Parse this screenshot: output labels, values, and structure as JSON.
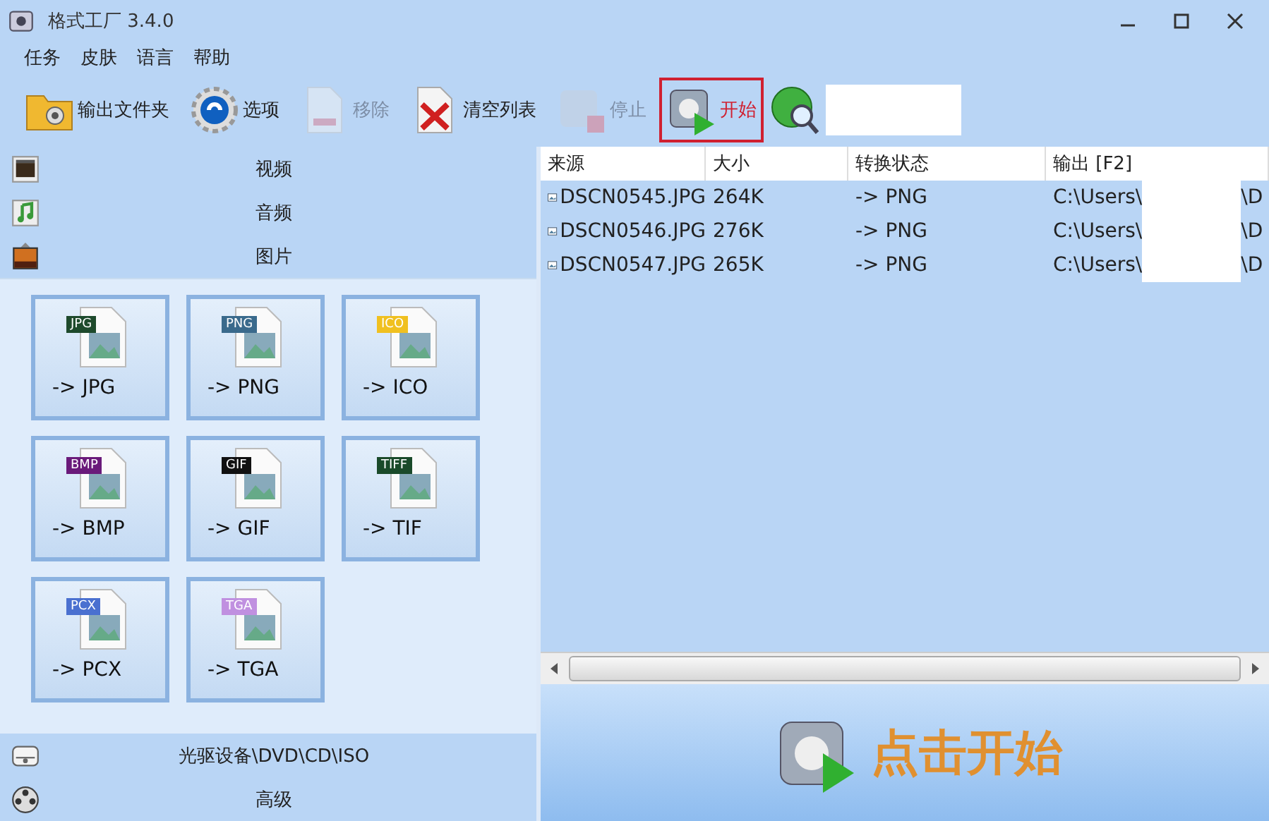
{
  "window": {
    "title": "格式工厂 3.4.0"
  },
  "menu": [
    "任务",
    "皮肤",
    "语言",
    "帮助"
  ],
  "toolbar": [
    {
      "label": "输出文件夹",
      "kind": "folder",
      "disabled": false,
      "selected": false
    },
    {
      "label": "选项",
      "kind": "gear",
      "disabled": false,
      "selected": false
    },
    {
      "label": "移除",
      "kind": "remove",
      "disabled": true,
      "selected": false
    },
    {
      "label": "清空列表",
      "kind": "clear",
      "disabled": false,
      "selected": false
    },
    {
      "label": "停止",
      "kind": "stop",
      "disabled": true,
      "selected": false
    },
    {
      "label": "开始",
      "kind": "start",
      "disabled": false,
      "selected": true
    }
  ],
  "sidebar": {
    "top": [
      {
        "label": "视频",
        "kind": "video",
        "expanded": false
      },
      {
        "label": "音频",
        "kind": "audio",
        "expanded": false
      },
      {
        "label": "图片",
        "kind": "picture",
        "expanded": true
      }
    ],
    "tiles": [
      {
        "label": "-> JPG",
        "tag": "JPG",
        "color": "#1e4a2c"
      },
      {
        "label": "-> PNG",
        "tag": "PNG",
        "color": "#3a6a8c"
      },
      {
        "label": "-> ICO",
        "tag": "ICO",
        "color": "#f0c020"
      },
      {
        "label": "-> BMP",
        "tag": "BMP",
        "color": "#6a1a7a"
      },
      {
        "label": "-> GIF",
        "tag": "GIF",
        "color": "#111111"
      },
      {
        "label": "-> TIF",
        "tag": "TIFF",
        "color": "#1a4a2a"
      },
      {
        "label": "-> PCX",
        "tag": "PCX",
        "color": "#4a70d0"
      },
      {
        "label": "-> TGA",
        "tag": "TGA",
        "color": "#c090e0"
      }
    ],
    "bottom": [
      {
        "label": "光驱设备\\DVD\\CD\\ISO",
        "kind": "disc"
      },
      {
        "label": "高级",
        "kind": "reel"
      }
    ]
  },
  "table": {
    "columns": [
      "来源",
      "大小",
      "转换状态",
      "输出 [F2]"
    ],
    "rows": [
      {
        "source": "DSCN0545.JPG",
        "size": "264K",
        "status": "-> PNG",
        "output_start": "C:\\Users\\",
        "output_end": "\\D"
      },
      {
        "source": "DSCN0546.JPG",
        "size": "276K",
        "status": "-> PNG",
        "output_start": "C:\\Users\\",
        "output_end": "\\D"
      },
      {
        "source": "DSCN0547.JPG",
        "size": "265K",
        "status": "-> PNG",
        "output_start": "C:\\Users\\",
        "output_end": "\\D"
      }
    ]
  },
  "banner": {
    "label": "点击开始"
  }
}
